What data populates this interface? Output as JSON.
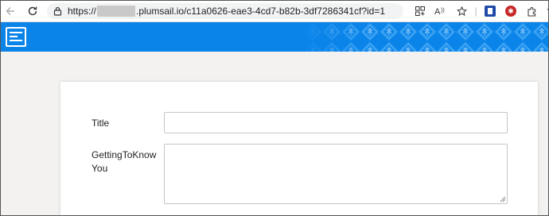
{
  "browser": {
    "url_scheme": "https://",
    "url_rest": ".plumsail.io/c11a0626-eae3-4cd7-b82b-3df7286341cf?id=1",
    "icons": {
      "back": "back-arrow-icon",
      "reload": "reload-icon",
      "lock": "lock-icon",
      "apps": "apps-icon",
      "read_aloud": "read-aloud-icon",
      "favorite": "star-icon",
      "extension_blue": "extension-icon",
      "extension_red": "extension-icon",
      "extensions": "puzzle-icon",
      "favorites": "favorites-icon"
    }
  },
  "header": {
    "banner_color": "#0b84ea",
    "logo_icon": "form-logo-icon"
  },
  "form": {
    "fields": [
      {
        "label": "Title",
        "value": "",
        "type": "text"
      },
      {
        "label": "GettingToKnow You",
        "value": "",
        "type": "textarea"
      }
    ]
  }
}
